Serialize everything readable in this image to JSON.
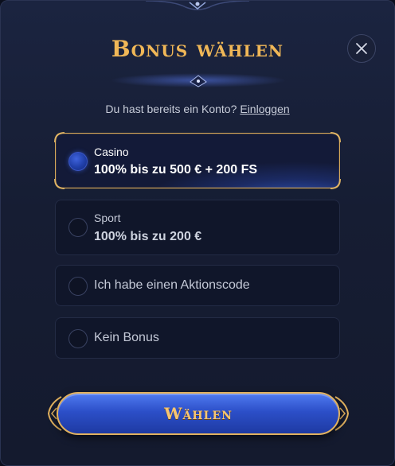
{
  "modal": {
    "title": "Bonus wählen",
    "close_icon": "close-icon"
  },
  "login": {
    "prompt": "Du hast bereits ein Konto?",
    "link_label": "Einloggen"
  },
  "options": [
    {
      "category": "Casino",
      "offer": "100% bis zu 500 € + 200 FS",
      "selected": true
    },
    {
      "category": "Sport",
      "offer": "100% bis zu 200 €",
      "selected": false
    },
    {
      "label": "Ich habe einen Aktionscode",
      "selected": false
    },
    {
      "label": "Kein Bonus",
      "selected": false
    }
  ],
  "cta": {
    "label": "Wählen"
  },
  "colors": {
    "accent_gold": "#f0b757",
    "button_blue": "#2c4fc8",
    "background": "#161d33"
  }
}
